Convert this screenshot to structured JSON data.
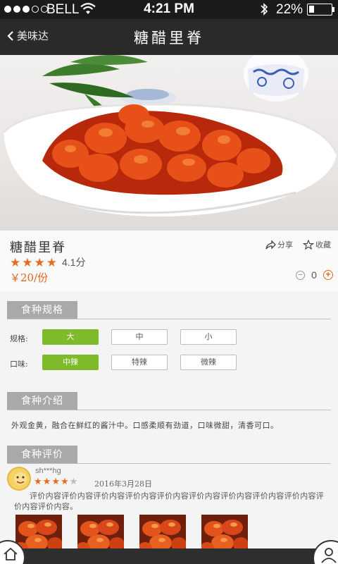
{
  "status_bar": {
    "carrier": "BELL",
    "time": "4:21 PM",
    "battery": "22%",
    "battery_level": 0.22,
    "signal_bars_filled": 3,
    "signal_bars_total": 5,
    "icons": [
      "signal-dots-icon",
      "wifi-icon",
      "bluetooth-icon",
      "battery-icon"
    ]
  },
  "nav": {
    "back_label": "美味达",
    "title": "糖醋里脊"
  },
  "dish": {
    "name": "糖醋里脊",
    "rating_stars": 4,
    "rating_text": "4.1分",
    "price": "￥20/份",
    "share_label": "分享",
    "favorite_label": "收藏",
    "quantity": "0"
  },
  "spec": {
    "header": "食种规格",
    "size_label": "规格:",
    "size_options": [
      "大",
      "中",
      "小"
    ],
    "size_selected": 0,
    "taste_label": "口味:",
    "taste_options": [
      "中辣",
      "特辣",
      "微辣"
    ],
    "taste_selected": 0
  },
  "intro": {
    "header": "食种介绍",
    "text": "外观金黄，融合在鲜红的酱汁中。口感柔顺有劲道，口味微甜，清香可口。"
  },
  "reviews": {
    "header": "食种评价",
    "items": [
      {
        "user": "sh***hg",
        "stars": 4,
        "date": "2016年3月28日",
        "text": "评价内容评价内容评价内容评价内容评价内容评价内容评价内容评价内容评价内容评价内容评价内容。"
      }
    ],
    "thumbnail_count": 4
  },
  "colors": {
    "accent_orange": "#e0651b",
    "selected_green": "#7fba2a",
    "section_gray": "#a9a9a9",
    "nav_dark": "#2a2a2a"
  }
}
